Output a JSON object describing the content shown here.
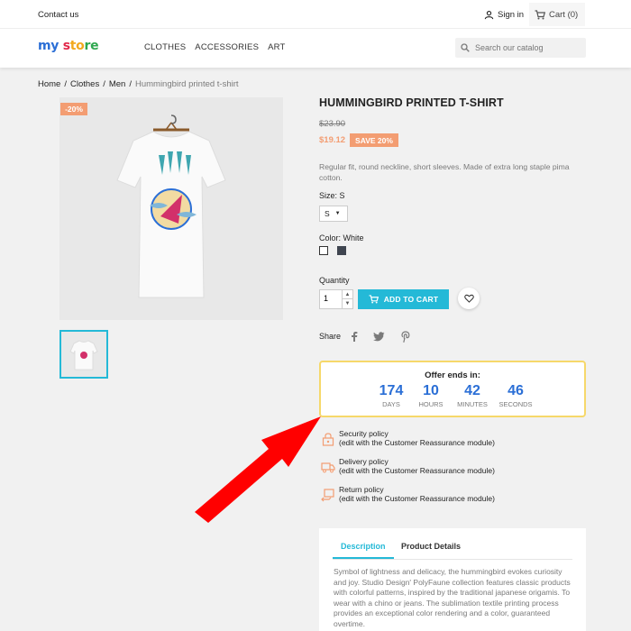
{
  "topnav": {
    "contact": "Contact us",
    "signin": "Sign in",
    "cart": "Cart (0)"
  },
  "header": {
    "logo": {
      "part1": "my ",
      "part2": "s",
      "part3": "to",
      "part4": "re"
    },
    "menu": [
      "CLOTHES",
      "ACCESSORIES",
      "ART"
    ],
    "search_placeholder": "Search our catalog"
  },
  "breadcrumb": [
    "Home",
    "Clothes",
    "Men",
    "Hummingbird printed t-shirt"
  ],
  "product": {
    "discount_badge": "-20%",
    "title": "HUMMINGBIRD PRINTED T-SHIRT",
    "old_price": "$23.90",
    "new_price": "$19.12",
    "save_badge": "SAVE 20%",
    "description": "Regular fit, round neckline, short sleeves. Made of extra long staple pima cotton.",
    "size_label": "Size: S",
    "size_value": "S",
    "color_label": "Color: White",
    "colors": [
      "#ffffff",
      "#3f4550"
    ],
    "quantity_label": "Quantity",
    "quantity_value": "1",
    "add_to_cart": "ADD TO CART",
    "share_label": "Share"
  },
  "countdown": {
    "title": "Offer ends in:",
    "units": [
      {
        "value": "174",
        "label": "DAYS"
      },
      {
        "value": "10",
        "label": "HOURS"
      },
      {
        "value": "42",
        "label": "MINUTES"
      },
      {
        "value": "46",
        "label": "SECONDS"
      }
    ]
  },
  "reassurance": [
    {
      "title": "Security policy",
      "sub": "(edit with the Customer Reassurance module)",
      "icon": "lock-icon"
    },
    {
      "title": "Delivery policy",
      "sub": "(edit with the Customer Reassurance module)",
      "icon": "truck-icon"
    },
    {
      "title": "Return policy",
      "sub": "(edit with the Customer Reassurance module)",
      "icon": "return-icon"
    }
  ],
  "tabs": {
    "description": "Description",
    "details": "Product Details",
    "text": "Symbol of lightness and delicacy, the hummingbird evokes curiosity and joy. Studio Design' PolyFaune collection features classic products with colorful patterns, inspired by the traditional japanese origamis. To wear with a chino or jeans. The sublimation textile printing process provides an exceptional color rendering and a color, guaranteed overtime."
  },
  "colors": {
    "accent": "#24b9d7",
    "sale": "#f39d72",
    "countdown_num": "#2b6fd6",
    "countdown_border": "#f6d86a",
    "arrow": "#ff0000"
  }
}
